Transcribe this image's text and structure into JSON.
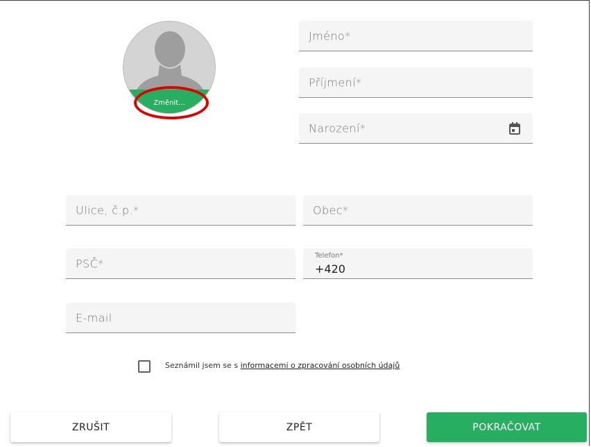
{
  "avatar": {
    "change_label": "Změnit..."
  },
  "fields": {
    "first_name": {
      "placeholder": "Jméno*"
    },
    "last_name": {
      "placeholder": "Příjmení*"
    },
    "birth_date": {
      "placeholder": "Narození*",
      "icon": "calendar-icon"
    },
    "street": {
      "placeholder": "Ulice, č.p.*"
    },
    "city": {
      "placeholder": "Obec*"
    },
    "zip": {
      "placeholder": "PSČ*"
    },
    "phone": {
      "label": "Telefon*",
      "value": "+420"
    },
    "email": {
      "placeholder": "E-mail"
    }
  },
  "consent": {
    "checked": false,
    "text": "Seznámil jsem se s ",
    "link": "informacemi o zpracování osobních údajů"
  },
  "buttons": {
    "cancel": "ZRUŠIT",
    "back": "ZPĚT",
    "continue": "POKRAČOVAT"
  },
  "colors": {
    "accent": "#27ae60",
    "highlight": "#e00000",
    "field_bg": "#f5f5f5"
  }
}
